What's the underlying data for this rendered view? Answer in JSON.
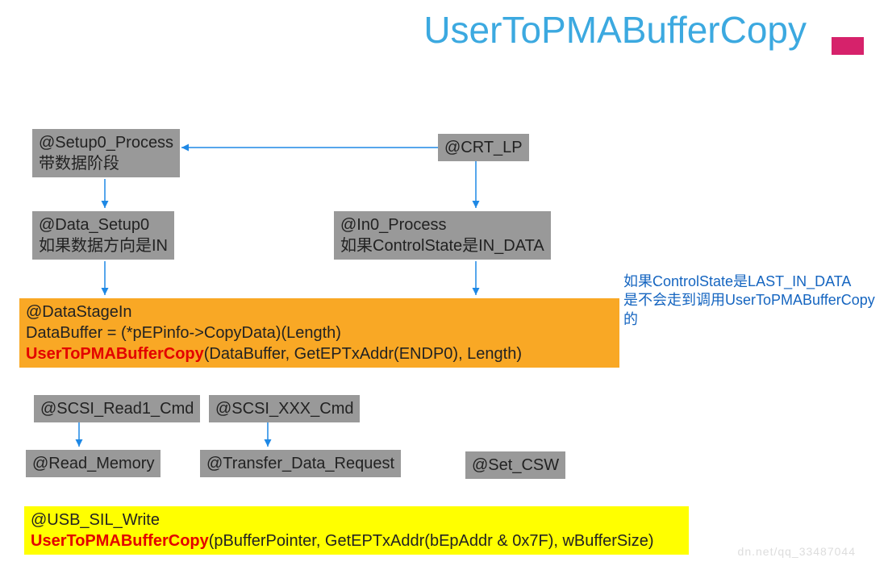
{
  "title": "UserToPMABufferCopy",
  "boxes": {
    "setup0": {
      "line1": "@Setup0_Process",
      "line2": "带数据阶段"
    },
    "crt_lp": {
      "line1": "@CRT_LP"
    },
    "data_setup0": {
      "line1": "@Data_Setup0",
      "line2": "如果数据方向是IN"
    },
    "in0_process": {
      "line1": "@In0_Process",
      "line2": "如果ControlState是IN_DATA"
    },
    "datastagein": {
      "line1": "@DataStageIn",
      "line2": "DataBuffer = (*pEPinfo->CopyData)(Length)",
      "fn": "UserToPMABufferCopy",
      "args": "(DataBuffer, GetEPTxAddr(ENDP0), Length)"
    },
    "scsi_read1": {
      "line1": "@SCSI_Read1_Cmd"
    },
    "scsi_xxx": {
      "line1": "@SCSI_XXX_Cmd"
    },
    "read_memory": {
      "line1": "@Read_Memory"
    },
    "transfer_data": {
      "line1": "@Transfer_Data_Request"
    },
    "set_csw": {
      "line1": "@Set_CSW"
    },
    "usb_sil_write": {
      "line1": "@USB_SIL_Write",
      "fn": "UserToPMABufferCopy",
      "args": "(pBufferPointer, GetEPTxAddr(bEpAddr & 0x7F), wBufferSize)"
    }
  },
  "note": {
    "line1": "如果ControlState是LAST_IN_DATA",
    "line2": "是不会走到调用UserToPMABufferCopy的"
  },
  "watermark": "dn.net/qq_33487044"
}
